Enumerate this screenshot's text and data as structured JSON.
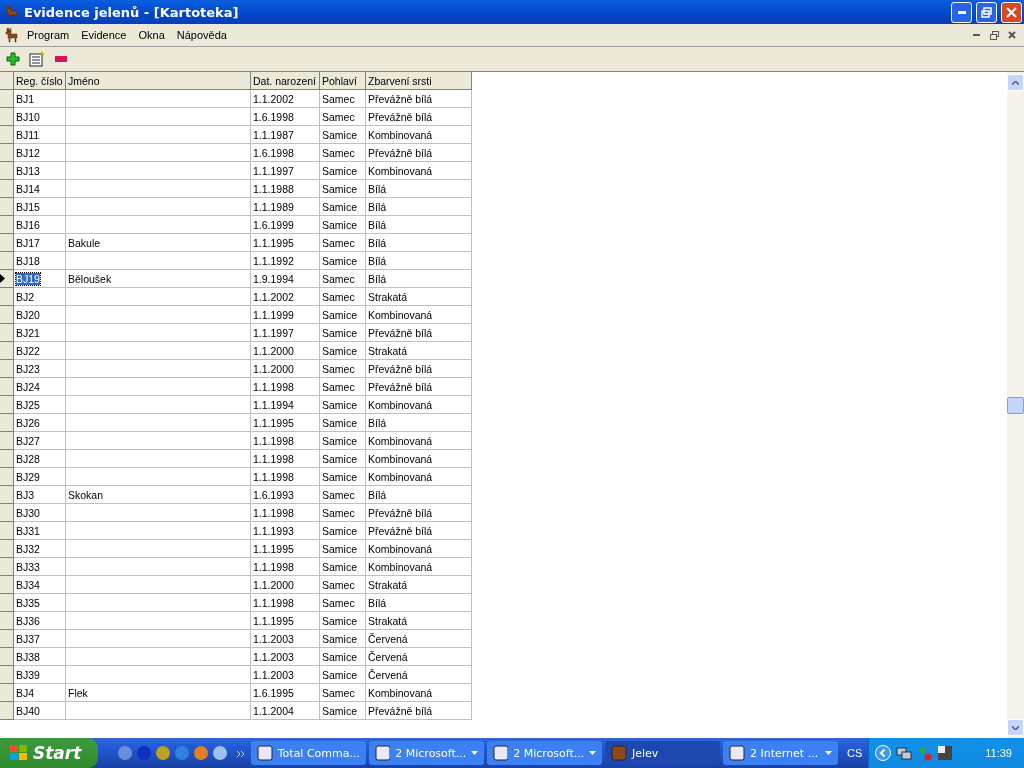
{
  "window": {
    "title": "Evidence jelenů - [Kartoteka]"
  },
  "menu": [
    "Program",
    "Evidence",
    "Okna",
    "Nápověda"
  ],
  "table": {
    "columns": [
      "Reg. číslo",
      "Jméno",
      "Dat. narození",
      "Pohlaví",
      "Zbarvení srsti"
    ],
    "rows": [
      {
        "reg": "BJ1",
        "name": "",
        "born": "1.1.2002",
        "sex": "Samec",
        "coat": "Převážně bílá",
        "selected": false
      },
      {
        "reg": "BJ10",
        "name": "",
        "born": "1.6.1998",
        "sex": "Samec",
        "coat": "Převážně bílá",
        "selected": false
      },
      {
        "reg": "BJ11",
        "name": "",
        "born": "1.1.1987",
        "sex": "Samice",
        "coat": "Kombinovaná",
        "selected": false
      },
      {
        "reg": "BJ12",
        "name": "",
        "born": "1.6.1998",
        "sex": "Samec",
        "coat": "Převážně bílá",
        "selected": false
      },
      {
        "reg": "BJ13",
        "name": "",
        "born": "1.1.1997",
        "sex": "Samice",
        "coat": "Kombinovaná",
        "selected": false
      },
      {
        "reg": "BJ14",
        "name": "",
        "born": "1.1.1988",
        "sex": "Samice",
        "coat": "Bílá",
        "selected": false
      },
      {
        "reg": "BJ15",
        "name": "",
        "born": "1.1.1989",
        "sex": "Samice",
        "coat": "Bílá",
        "selected": false
      },
      {
        "reg": "BJ16",
        "name": "",
        "born": "1.6.1999",
        "sex": "Samice",
        "coat": "Bílá",
        "selected": false
      },
      {
        "reg": "BJ17",
        "name": "Bakule",
        "born": "1.1.1995",
        "sex": "Samec",
        "coat": "Bílá",
        "selected": false
      },
      {
        "reg": "BJ18",
        "name": "",
        "born": "1.1.1992",
        "sex": "Samice",
        "coat": "Bílá",
        "selected": false
      },
      {
        "reg": "BJ19",
        "name": "Běloušek",
        "born": "1.9.1994",
        "sex": "Samec",
        "coat": "Bílá",
        "selected": true
      },
      {
        "reg": "BJ2",
        "name": "",
        "born": "1.1.2002",
        "sex": "Samec",
        "coat": "Strakatá",
        "selected": false
      },
      {
        "reg": "BJ20",
        "name": "",
        "born": "1.1.1999",
        "sex": "Samice",
        "coat": "Kombinovaná",
        "selected": false
      },
      {
        "reg": "BJ21",
        "name": "",
        "born": "1.1.1997",
        "sex": "Samice",
        "coat": "Převážně bílá",
        "selected": false
      },
      {
        "reg": "BJ22",
        "name": "",
        "born": "1.1.2000",
        "sex": "Samice",
        "coat": "Strakatá",
        "selected": false
      },
      {
        "reg": "BJ23",
        "name": "",
        "born": "1.1.2000",
        "sex": "Samec",
        "coat": "Převážně bílá",
        "selected": false
      },
      {
        "reg": "BJ24",
        "name": "",
        "born": "1.1.1998",
        "sex": "Samec",
        "coat": "Převážně bílá",
        "selected": false
      },
      {
        "reg": "BJ25",
        "name": "",
        "born": "1.1.1994",
        "sex": "Samice",
        "coat": "Kombinovaná",
        "selected": false
      },
      {
        "reg": "BJ26",
        "name": "",
        "born": "1.1.1995",
        "sex": "Samice",
        "coat": "Bílá",
        "selected": false
      },
      {
        "reg": "BJ27",
        "name": "",
        "born": "1.1.1998",
        "sex": "Samice",
        "coat": "Kombinovaná",
        "selected": false
      },
      {
        "reg": "BJ28",
        "name": "",
        "born": "1.1.1998",
        "sex": "Samice",
        "coat": "Kombinovaná",
        "selected": false
      },
      {
        "reg": "BJ29",
        "name": "",
        "born": "1.1.1998",
        "sex": "Samice",
        "coat": "Kombinovaná",
        "selected": false
      },
      {
        "reg": "BJ3",
        "name": "Skokan",
        "born": "1.6.1993",
        "sex": "Samec",
        "coat": "Bílá",
        "selected": false
      },
      {
        "reg": "BJ30",
        "name": "",
        "born": "1.1.1998",
        "sex": "Samec",
        "coat": "Převážně bílá",
        "selected": false
      },
      {
        "reg": "BJ31",
        "name": "",
        "born": "1.1.1993",
        "sex": "Samice",
        "coat": "Převážně bílá",
        "selected": false
      },
      {
        "reg": "BJ32",
        "name": "",
        "born": "1.1.1995",
        "sex": "Samice",
        "coat": "Kombinovaná",
        "selected": false
      },
      {
        "reg": "BJ33",
        "name": "",
        "born": "1.1.1998",
        "sex": "Samice",
        "coat": "Kombinovaná",
        "selected": false
      },
      {
        "reg": "BJ34",
        "name": "",
        "born": "1.1.2000",
        "sex": "Samec",
        "coat": "Strakatá",
        "selected": false
      },
      {
        "reg": "BJ35",
        "name": "",
        "born": "1.1.1998",
        "sex": "Samec",
        "coat": "Bílá",
        "selected": false
      },
      {
        "reg": "BJ36",
        "name": "",
        "born": "1.1.1995",
        "sex": "Samice",
        "coat": "Strakatá",
        "selected": false
      },
      {
        "reg": "BJ37",
        "name": "",
        "born": "1.1.2003",
        "sex": "Samice",
        "coat": "Červená",
        "selected": false
      },
      {
        "reg": "BJ38",
        "name": "",
        "born": "1.1.2003",
        "sex": "Samice",
        "coat": "Červená",
        "selected": false
      },
      {
        "reg": "BJ39",
        "name": "",
        "born": "1.1.2003",
        "sex": "Samice",
        "coat": "Červená",
        "selected": false
      },
      {
        "reg": "BJ4",
        "name": "Flek",
        "born": "1.6.1995",
        "sex": "Samec",
        "coat": "Kombinovaná",
        "selected": false
      },
      {
        "reg": "BJ40",
        "name": "",
        "born": "1.1.2004",
        "sex": "Samice",
        "coat": "Převážně bílá",
        "selected": false
      }
    ]
  },
  "taskbar": {
    "start": "Start",
    "buttons": [
      {
        "label": "Total Comma...",
        "group": false,
        "selected": false
      },
      {
        "label": "2 Microsoft...",
        "group": true,
        "selected": false
      },
      {
        "label": "2 Microsoft...",
        "group": true,
        "selected": false
      },
      {
        "label": "Jelev",
        "group": false,
        "selected": true
      },
      {
        "label": "2 Internet ...",
        "group": true,
        "selected": false
      }
    ],
    "language": "CS",
    "clock": "11:39"
  }
}
